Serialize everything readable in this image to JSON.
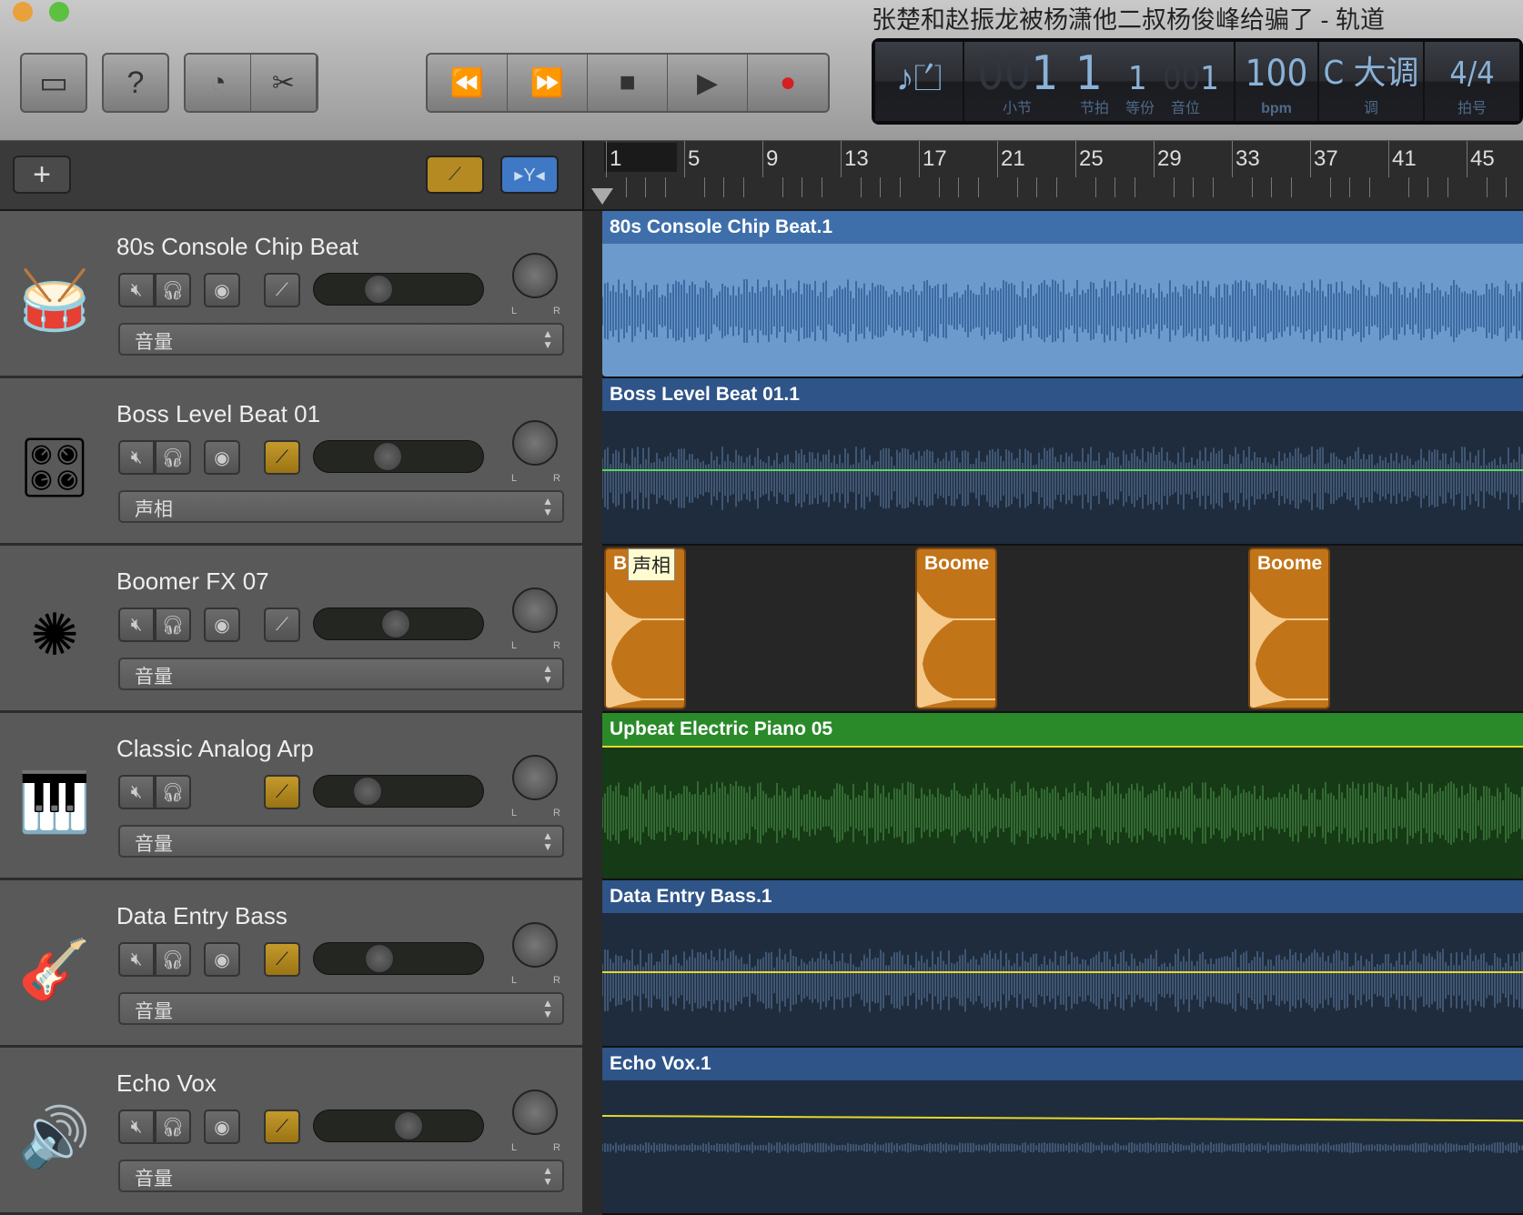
{
  "window": {
    "title": "张楚和赵振龙被杨潇他二叔杨俊峰给骗了 - 轨道"
  },
  "toolbar": {
    "library": "library-icon",
    "help": "?",
    "smart_controls": "smart-controls-icon",
    "editors": "scissors-icon",
    "transport": {
      "rewind": "⏪",
      "forward": "⏩",
      "stop": "■",
      "play": "▶",
      "record": "●"
    }
  },
  "lcd": {
    "bar": "1",
    "bar_dim": "00",
    "bar_label": "小节",
    "beat": "1",
    "beat_label": "节拍",
    "division": "1",
    "division_label": "等份",
    "tick": "1",
    "tick_dim": "00",
    "tick_label": "音位",
    "tempo": "100",
    "tempo_label": "bpm",
    "key": "C 大调",
    "key_label": "调",
    "signature": "4/4",
    "signature_label": "拍号"
  },
  "header": {
    "add": "+"
  },
  "ruler": {
    "bars": [
      "1",
      "5",
      "9",
      "13",
      "17",
      "21",
      "25",
      "29",
      "33",
      "37",
      "41",
      "45"
    ]
  },
  "tracks": [
    {
      "name": "80s Console Chip Beat",
      "region": "80s Console Chip Beat.1",
      "param": "音量",
      "volume": 0.35,
      "automation_on": false,
      "monitor": true,
      "color": "#4a78b0"
    },
    {
      "name": "Boss Level Beat 01",
      "region": "Boss Level Beat 01.1",
      "param": "声相",
      "volume": 0.42,
      "automation_on": true,
      "monitor": true,
      "color": "#2e5488"
    },
    {
      "name": "Boomer FX 07",
      "region": "Boome",
      "region_first": "B",
      "tooltip": "声相",
      "param": "音量",
      "volume": 0.48,
      "automation_on": false,
      "monitor": true,
      "color": "#c27419"
    },
    {
      "name": "Classic Analog Arp",
      "region": "Upbeat Electric Piano 05",
      "param": "音量",
      "volume": 0.27,
      "automation_on": true,
      "monitor": false,
      "color": "#2a8a2a"
    },
    {
      "name": "Data Entry Bass",
      "region": "Data Entry Bass.1",
      "param": "音量",
      "volume": 0.36,
      "automation_on": true,
      "monitor": true,
      "color": "#2e5488"
    },
    {
      "name": "Echo Vox",
      "region": "Echo Vox.1",
      "param": "音量",
      "volume": 0.57,
      "automation_on": true,
      "monitor": true,
      "color": "#2e5488"
    }
  ],
  "pan_labels": {
    "l": "L",
    "r": "R"
  }
}
